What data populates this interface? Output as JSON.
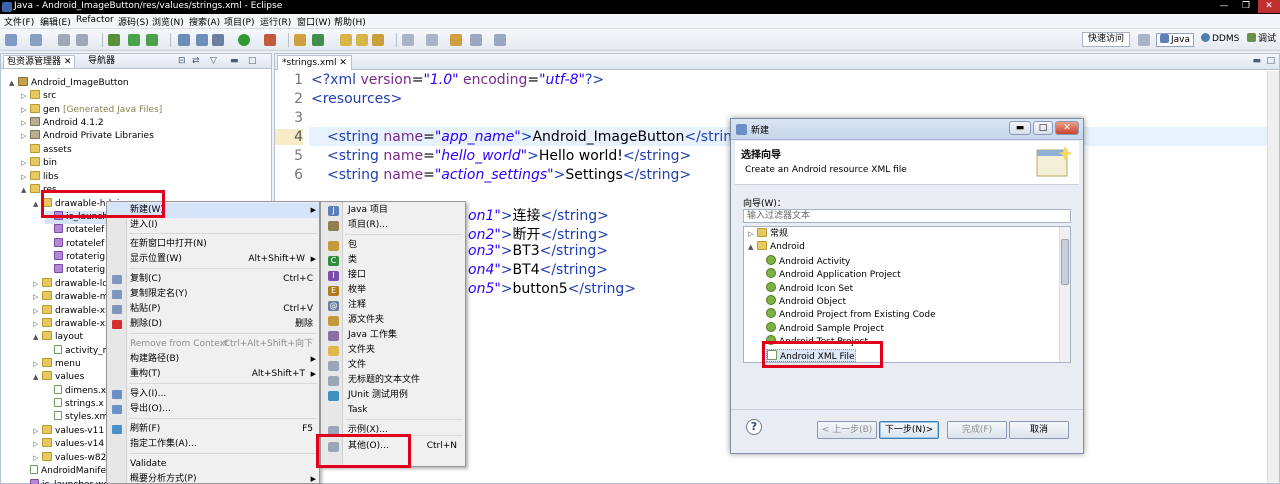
{
  "window": {
    "title": "Java - Android_ImageButton/res/values/strings.xml - Eclipse"
  },
  "menubar": [
    "文件(F)",
    "编辑(E)",
    "Refactor",
    "源码(S)",
    "浏览(N)",
    "搜索(A)",
    "项目(P)",
    "运行(R)",
    "窗口(W)",
    "帮助(H)"
  ],
  "toolbar": {
    "quick_access": "快速访问",
    "perspectives": [
      "Java",
      "DDMS",
      "调试"
    ]
  },
  "left_panel": {
    "tabs": [
      "包资源管理器",
      "导航器"
    ],
    "tree": [
      {
        "label": "Android_ImageButton",
        "arrow": "▲",
        "icon": "project"
      },
      {
        "label": "src",
        "arrow": "▷",
        "icon": "pkgfolder"
      },
      {
        "label": "gen",
        "decor": "[Generated Java Files]",
        "arrow": "▷",
        "icon": "pkgfolder"
      },
      {
        "label": "Android 4.1.2",
        "arrow": "▷",
        "icon": "lib"
      },
      {
        "label": "Android Private Libraries",
        "arrow": "▷",
        "icon": "lib"
      },
      {
        "label": "assets",
        "arrow": "",
        "icon": "folder"
      },
      {
        "label": "bin",
        "arrow": "▷",
        "icon": "folder"
      },
      {
        "label": "libs",
        "arrow": "▷",
        "icon": "folder"
      },
      {
        "label": "res",
        "arrow": "▲",
        "icon": "folder"
      },
      {
        "label": "drawable-hdpi",
        "arrow": "▲",
        "icon": "folder"
      },
      {
        "label": "ic_launch",
        "arrow": "",
        "icon": "img"
      },
      {
        "label": "rotatelef",
        "arrow": "",
        "icon": "img"
      },
      {
        "label": "rotatelef",
        "arrow": "",
        "icon": "img"
      },
      {
        "label": "rotaterig",
        "arrow": "",
        "icon": "img"
      },
      {
        "label": "rotaterig",
        "arrow": "",
        "icon": "img"
      },
      {
        "label": "drawable-ld",
        "arrow": "▷",
        "icon": "folder"
      },
      {
        "label": "drawable-m",
        "arrow": "▷",
        "icon": "folder"
      },
      {
        "label": "drawable-xh",
        "arrow": "▷",
        "icon": "folder"
      },
      {
        "label": "drawable-xx",
        "arrow": "▷",
        "icon": "folder"
      },
      {
        "label": "layout",
        "arrow": "▲",
        "icon": "folder"
      },
      {
        "label": "activity_m",
        "arrow": "",
        "icon": "xml"
      },
      {
        "label": "menu",
        "arrow": "▷",
        "icon": "folder"
      },
      {
        "label": "values",
        "arrow": "▲",
        "icon": "folder"
      },
      {
        "label": "dimens.x",
        "arrow": "",
        "icon": "xml"
      },
      {
        "label": "strings.x",
        "arrow": "",
        "icon": "xml"
      },
      {
        "label": "styles.xm",
        "arrow": "",
        "icon": "xml"
      },
      {
        "label": "values-v11",
        "arrow": "▷",
        "icon": "folder"
      },
      {
        "label": "values-v14",
        "arrow": "▷",
        "icon": "folder"
      },
      {
        "label": "values-w820",
        "arrow": "▷",
        "icon": "folder"
      },
      {
        "label": "AndroidManife",
        "arrow": "",
        "icon": "xml"
      },
      {
        "label": "ic_launcher-web",
        "arrow": "",
        "icon": "img"
      }
    ]
  },
  "editor": {
    "tab": "*strings.xml",
    "line_numbers": [
      "1",
      "2",
      "3",
      "4",
      "5",
      "6"
    ],
    "lines": {
      "l1": {
        "a": "<?xml ",
        "b": "version",
        "c": "=",
        "d": "\"1.0\"",
        "e": " encoding",
        "f": "=",
        "g": "\"utf-8\"",
        "h": "?>"
      },
      "l2": "<resources>",
      "l4": {
        "open": "<string ",
        "attr": "name",
        "eq": "=",
        "val": "\"app_name\"",
        "close": ">",
        "text": "Android_ImageButton",
        "end": "</string"
      },
      "l5": {
        "open": "<string ",
        "attr": "name",
        "eq": "=",
        "val": "\"hello_world\"",
        "close": ">",
        "text": "Hello world!",
        "end": "</string>"
      },
      "l6": {
        "open": "<string ",
        "attr": "name",
        "eq": "=",
        "val": "\"action_settings\"",
        "close": ">",
        "text": "Settings",
        "end": "</string>"
      },
      "p7": {
        "val": "on1\"",
        "close": ">",
        "text": "连接",
        "end": "</string>"
      },
      "p8": {
        "val": "on2\"",
        "close": ">",
        "text": "断开",
        "end": "</string>"
      },
      "p9": {
        "val": "on3\"",
        "close": ">",
        "text": "BT3",
        "end": "</string>"
      },
      "p10": {
        "val": "on4\"",
        "close": ">",
        "text": "BT4",
        "end": "</string>"
      },
      "p11": {
        "val": "on5\"",
        "close": ">",
        "text": "button5",
        "end": "</string>"
      }
    }
  },
  "context_menu": {
    "items": [
      {
        "label": "新建(W)",
        "shortcut": "",
        "submenu": true,
        "disabled": false,
        "hot": true
      },
      {
        "label": "进入(I)",
        "shortcut": "",
        "submenu": false,
        "disabled": false
      },
      {
        "label": "在新窗口中打开(N)",
        "shortcut": "",
        "submenu": false,
        "disabled": false
      },
      {
        "label": "显示位置(W)",
        "shortcut": "Alt+Shift+W",
        "submenu": true,
        "disabled": false
      },
      {
        "label": "复制(C)",
        "shortcut": "Ctrl+C",
        "submenu": false,
        "disabled": false
      },
      {
        "label": "复制限定名(Y)",
        "shortcut": "",
        "submenu": false,
        "disabled": false
      },
      {
        "label": "粘贴(P)",
        "shortcut": "Ctrl+V",
        "submenu": false,
        "disabled": false
      },
      {
        "label": "删除(D)",
        "shortcut": "删除",
        "submenu": false,
        "disabled": false
      },
      {
        "label": "Remove from Context",
        "shortcut": "Ctrl+Alt+Shift+向下",
        "submenu": false,
        "disabled": true
      },
      {
        "label": "构建路径(B)",
        "shortcut": "",
        "submenu": true,
        "disabled": false
      },
      {
        "label": "重构(T)",
        "shortcut": "Alt+Shift+T",
        "submenu": true,
        "disabled": false
      },
      {
        "label": "导入(I)...",
        "shortcut": "",
        "submenu": false,
        "disabled": false
      },
      {
        "label": "导出(O)...",
        "shortcut": "",
        "submenu": false,
        "disabled": false
      },
      {
        "label": "刷新(F)",
        "shortcut": "F5",
        "submenu": false,
        "disabled": false
      },
      {
        "label": "指定工作集(A)...",
        "shortcut": "",
        "submenu": false,
        "disabled": false
      },
      {
        "label": "Validate",
        "shortcut": "",
        "submenu": false,
        "disabled": false
      },
      {
        "label": "概要分析方式(P)",
        "shortcut": "",
        "submenu": true,
        "disabled": false
      }
    ]
  },
  "submenu": {
    "items": [
      {
        "label": "Java 项目",
        "shortcut": "",
        "icon": "J",
        "color": "#5b7fb8"
      },
      {
        "label": "项目(R)...",
        "shortcut": "",
        "icon": "",
        "color": "#8f7f50"
      },
      {
        "label": "包",
        "shortcut": "",
        "icon": "",
        "color": "#c49a3c"
      },
      {
        "label": "类",
        "shortcut": "",
        "icon": "C",
        "color": "#2f8f3f"
      },
      {
        "label": "接口",
        "shortcut": "",
        "icon": "I",
        "color": "#7a4ea8"
      },
      {
        "label": "枚举",
        "shortcut": "",
        "icon": "E",
        "color": "#b07a1e"
      },
      {
        "label": "注释",
        "shortcut": "",
        "icon": "@",
        "color": "#6a7fa0"
      },
      {
        "label": "源文件夹",
        "shortcut": "",
        "icon": "",
        "color": "#c49a3c"
      },
      {
        "label": "Java 工作集",
        "shortcut": "",
        "icon": "",
        "color": "#8a6fa4"
      },
      {
        "label": "文件夹",
        "shortcut": "",
        "icon": "",
        "color": "#e0b84a"
      },
      {
        "label": "文件",
        "shortcut": "",
        "icon": "",
        "color": "#9aa6b8"
      },
      {
        "label": "无标题的文本文件",
        "shortcut": "",
        "icon": "",
        "color": "#9aa6b8"
      },
      {
        "label": "JUnit 测试用例",
        "shortcut": "",
        "icon": "",
        "color": "#3f8fbf"
      },
      {
        "label": "Task",
        "shortcut": "",
        "icon": "",
        "color": ""
      },
      {
        "label": "示例(X)...",
        "shortcut": "",
        "icon": "",
        "color": "#9aa6b8"
      },
      {
        "label": "其他(O)...",
        "shortcut": "Ctrl+N",
        "icon": "",
        "color": "#9aa6b8"
      }
    ]
  },
  "dialog": {
    "title": "新建",
    "header_title": "选择向导",
    "header_desc": "Create an Android resource XML file",
    "wizards_label": "向导(W)：",
    "filter_placeholder": "输入过滤器文本",
    "tree": [
      {
        "label": "常规",
        "arrow": "▷",
        "kind": "folder",
        "indent": 0
      },
      {
        "label": "Android",
        "arrow": "▲",
        "kind": "folder",
        "indent": 0
      },
      {
        "label": "Android Activity",
        "arrow": "",
        "kind": "item",
        "indent": 1
      },
      {
        "label": "Android Application Project",
        "arrow": "",
        "kind": "item",
        "indent": 1
      },
      {
        "label": "Android Icon Set",
        "arrow": "",
        "kind": "item",
        "indent": 1
      },
      {
        "label": "Android Object",
        "arrow": "",
        "kind": "item",
        "indent": 1
      },
      {
        "label": "Android Project from Existing Code",
        "arrow": "",
        "kind": "item",
        "indent": 1
      },
      {
        "label": "Android Sample Project",
        "arrow": "",
        "kind": "item",
        "indent": 1
      },
      {
        "label": "Android Test Project",
        "arrow": "",
        "kind": "item",
        "indent": 1
      },
      {
        "label": "Android XML File",
        "arrow": "",
        "kind": "item",
        "indent": 1,
        "selected": true
      }
    ],
    "buttons": {
      "back": "< 上一步(B)",
      "next": "下一步(N)>",
      "finish": "完成(F)",
      "cancel": "取消"
    },
    "help": "?"
  },
  "colors": {
    "highlight_box": "#e0001b",
    "tag": "#1f3fb0",
    "attr": "#7a2a8e",
    "string_value": "#2a00ff"
  }
}
